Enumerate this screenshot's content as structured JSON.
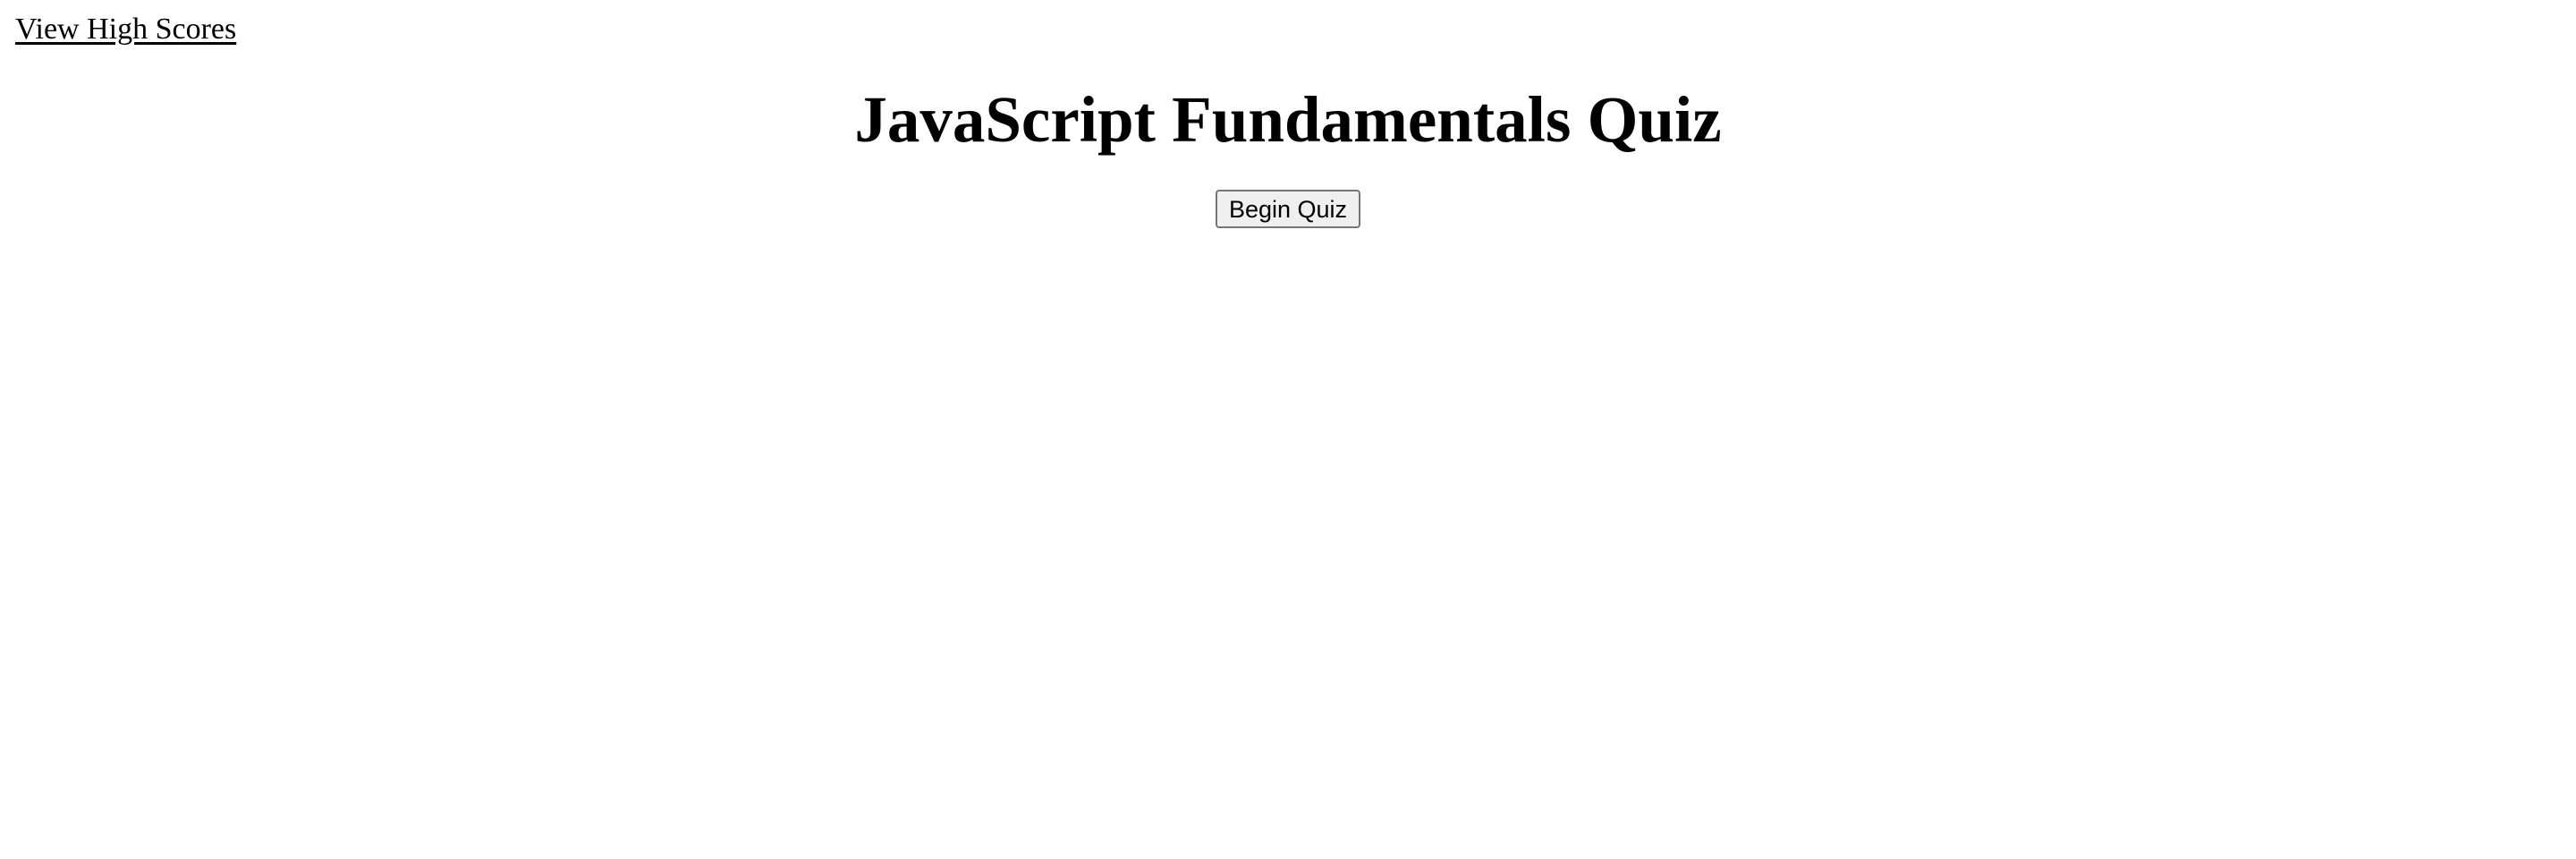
{
  "nav": {
    "high_scores_label": "View High Scores"
  },
  "main": {
    "title": "JavaScript Fundamentals Quiz",
    "start_button_label": "Begin Quiz"
  },
  "colors": {
    "text": "#000000",
    "background": "#ffffff",
    "button_background": "#efefef",
    "button_border": "#767676"
  }
}
